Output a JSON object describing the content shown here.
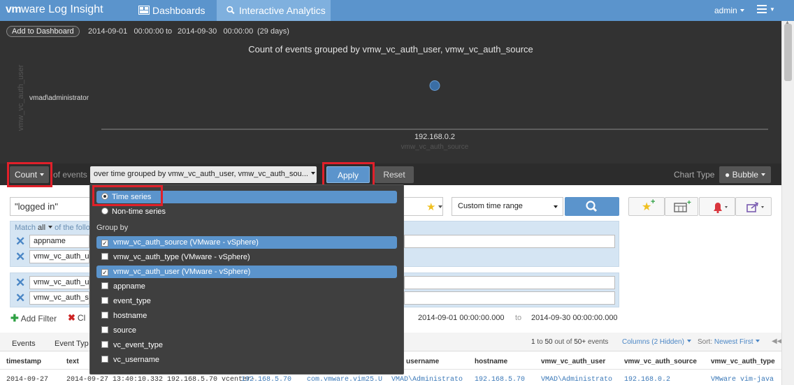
{
  "brand": {
    "logo_vm": "vm",
    "logo_ware": "ware",
    "product": "Log Insight"
  },
  "nav": {
    "tabs": [
      {
        "label": "Dashboards",
        "active": false
      },
      {
        "label": "Interactive Analytics",
        "active": true
      }
    ],
    "user": "admin",
    "accent": "#5b94cc"
  },
  "chart_header": {
    "add_to_dashboard": "Add to Dashboard",
    "start_date": "2014-09-01",
    "start_time": "00:00:00",
    "to": "to",
    "end_date": "2014-09-30",
    "end_time": "00:00:00",
    "duration": "(29 days)"
  },
  "chart_data": {
    "type": "scatter",
    "subtype": "bubble",
    "title": "Count of events grouped by vmw_vc_auth_user, vmw_vc_auth_source",
    "xlabel": "vmw_vc_auth_source",
    "ylabel": "vmw_vc_auth_user",
    "x_categories": [
      "192.168.0.2"
    ],
    "y_categories": [
      "vmad\\administrator"
    ],
    "points": [
      {
        "x": "192.168.0.2",
        "y": "vmad\\administrator"
      }
    ],
    "bubble_color": "#3a6ea5"
  },
  "toolbar": {
    "aggregate": "Count",
    "of_events": "of events",
    "group_by": "over time grouped by vmw_vc_auth_user, vmw_vc_auth_sou...",
    "apply": "Apply",
    "reset": "Reset",
    "chart_type_label": "Chart Type",
    "chart_type": "Bubble"
  },
  "search": {
    "query": "\"logged in\"",
    "time_range": "Custom time range"
  },
  "filters": {
    "match_prefix": "Match",
    "match_mode": "all",
    "match_suffix": "of the follo",
    "group1": [
      "appname",
      "vmw_vc_auth_u"
    ],
    "group2": [
      "vmw_vc_auth_u",
      "vmw_vc_auth_s"
    ],
    "add_filter": "Add Filter",
    "clear": "Cl",
    "range_start": "2014-09-01  00:00:00.000",
    "range_to": "to",
    "range_end": "2014-09-30  00:00:00.000"
  },
  "dropdown": {
    "modes": [
      {
        "label": "Time series",
        "selected": true
      },
      {
        "label": "Non-time series",
        "selected": false
      }
    ],
    "group_by_label": "Group by",
    "fields": [
      {
        "label": "vmw_vc_auth_source (VMware - vSphere)",
        "checked": true,
        "mark": "✓"
      },
      {
        "label": "vmw_vc_auth_type (VMware - vSphere)",
        "checked": false,
        "mark": ""
      },
      {
        "label": "vmw_vc_auth_user (VMware - vSphere)",
        "checked": true,
        "mark": "✓"
      },
      {
        "label": "appname",
        "checked": false,
        "mark": ""
      },
      {
        "label": "event_type",
        "checked": false,
        "mark": ""
      },
      {
        "label": "hostname",
        "checked": false,
        "mark": ""
      },
      {
        "label": "source",
        "checked": false,
        "mark": ""
      },
      {
        "label": "vc_event_type",
        "checked": false,
        "mark": ""
      },
      {
        "label": "vc_username",
        "checked": false,
        "mark": ""
      }
    ]
  },
  "results": {
    "tabs": [
      "Events",
      "Event Typ"
    ],
    "range_a": "1",
    "range_to": "to",
    "range_b": "50",
    "range_outof": "out of",
    "range_total": "50+",
    "range_events": "events",
    "columns": "Columns (2 Hidden)",
    "sort_label": "Sort:",
    "sort_value": "Newest First",
    "headers": [
      "timestamp",
      "text",
      "username",
      "hostname",
      "vmw_vc_auth_user",
      "vmw_vc_auth_source",
      "vmw_vc_auth_type"
    ],
    "row": {
      "timestamp": "2014-09-27",
      "text": "2014-09-27 13:40:10.332 192.168.5.70 vcenter-",
      "source": "192.168.5.70",
      "appname": "com.vmware.vim25.U",
      "username": "VMAD\\Administrato",
      "hostname": "192.168.5.70",
      "auth_user": "VMAD\\Administrato",
      "auth_source": "192.168.0.2",
      "auth_type": "VMware vim-java"
    }
  }
}
